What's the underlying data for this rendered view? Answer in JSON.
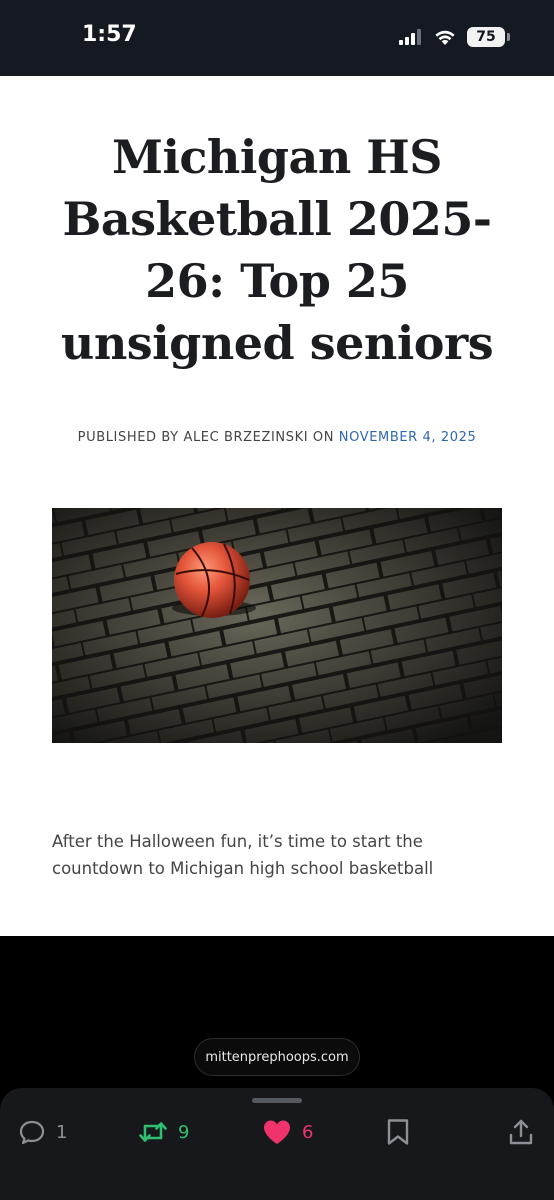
{
  "status_bar": {
    "time": "1:57",
    "battery": "75",
    "icons": [
      "cellular-signal-icon",
      "wifi-icon",
      "battery-icon"
    ]
  },
  "article": {
    "title": "Michigan HS Basketball 2025-26: Top 25 unsigned seniors",
    "byline_prefix": "PUBLISHED BY ALEC BRZEZINSKI ON ",
    "date": "NOVEMBER 4, 2025",
    "excerpt": "After the Halloween fun, it’s time to start the countdown to Michigan high school basketball",
    "image": "basketball-on-pavement-photo"
  },
  "link": {
    "domain": "mittenprephoops.com"
  },
  "actions": {
    "reply_count": "1",
    "repost_count": "9",
    "like_count": "6"
  },
  "colors": {
    "link_date": "#2f66b3",
    "repost": "#2fbf71",
    "like": "#f0336c"
  }
}
